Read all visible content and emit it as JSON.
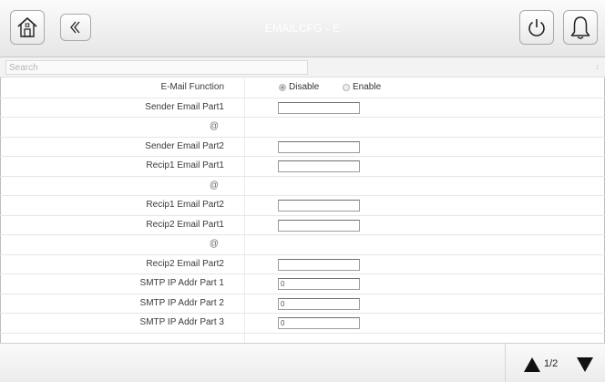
{
  "header": {
    "title": "EMAILCFG - E",
    "home_icon": "home-icon",
    "back_icon": "double-chevron-left-icon",
    "power_icon": "power-icon",
    "bell_icon": "bell-icon"
  },
  "search": {
    "placeholder": "Search",
    "value": "",
    "sort_icon": "sort-icon",
    "sort_glyph": "↕"
  },
  "rows": [
    {
      "label": "E-Mail Function",
      "type": "radio",
      "options": [
        "Disable",
        "Enable"
      ],
      "selected": "Disable"
    },
    {
      "label": "Sender Email Part1",
      "type": "text",
      "value": ""
    },
    {
      "label": "@",
      "type": "separator"
    },
    {
      "label": "Sender Email Part2",
      "type": "text",
      "value": ""
    },
    {
      "label": "Recip1 Email Part1",
      "type": "text",
      "value": ""
    },
    {
      "label": "@",
      "type": "separator"
    },
    {
      "label": "Recip1 Email Part2",
      "type": "text",
      "value": ""
    },
    {
      "label": "Recip2 Email Part1",
      "type": "text",
      "value": ""
    },
    {
      "label": "@",
      "type": "separator"
    },
    {
      "label": "Recip2 Email Part2",
      "type": "text",
      "value": ""
    },
    {
      "label": "SMTP IP Addr Part 1",
      "type": "text",
      "value": "0"
    },
    {
      "label": "SMTP IP Addr Part 2",
      "type": "text",
      "value": "0"
    },
    {
      "label": "SMTP IP Addr Part 3",
      "type": "text",
      "value": "0"
    }
  ],
  "footer": {
    "page": "1/2",
    "up_icon": "page-up-icon",
    "down_icon": "page-down-icon"
  }
}
